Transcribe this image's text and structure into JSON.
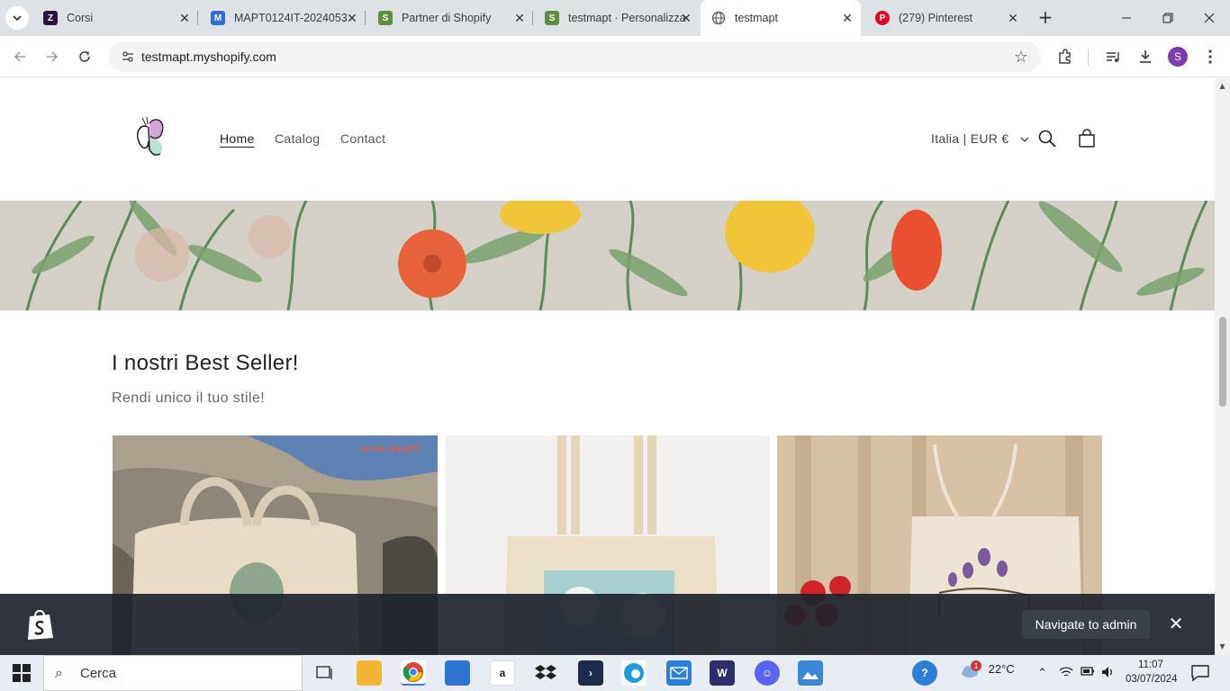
{
  "browser": {
    "tabs": [
      {
        "title": "Corsi",
        "favicon_color": "#2b1340",
        "favicon_glyph": "Z"
      },
      {
        "title": "MAPT0124IT-2024053",
        "favicon_color": "#2b6fd6",
        "favicon_glyph": "M"
      },
      {
        "title": "Partner di Shopify",
        "favicon_color": "#5e8e3e",
        "favicon_glyph": "S"
      },
      {
        "title": "testmapt · Personalizza",
        "favicon_color": "#5e8e3e",
        "favicon_glyph": "S"
      },
      {
        "title": "testmapt",
        "favicon_color": "#5f6368",
        "favicon_glyph": "globe-icon"
      },
      {
        "title": "(279) Pinterest",
        "favicon_color": "#e60023",
        "favicon_glyph": "P"
      }
    ],
    "active_tab_index": 4,
    "url": "testmapt.myshopify.com",
    "profile_initial": "S"
  },
  "store": {
    "nav": [
      {
        "label": "Home",
        "active": true
      },
      {
        "label": "Catalog",
        "active": false
      },
      {
        "label": "Contact",
        "active": false
      }
    ],
    "locale": "Italia | EUR €",
    "section_title": "I nostri Best Seller!",
    "section_subtitle": "Rendi unico il tuo stile!",
    "product_watermark": "www.wagrill"
  },
  "admin_bar": {
    "navigate_label": "Navigate to admin"
  },
  "taskbar": {
    "search_placeholder": "Cerca",
    "weather": "22°C",
    "time": "11:07",
    "date": "03/07/2024",
    "weather_badge": "1"
  },
  "colors": {
    "accent_purple": "#7b3bb0",
    "shopify_green": "#5e8e3e",
    "admin_bar_bg": "#1e232d"
  }
}
